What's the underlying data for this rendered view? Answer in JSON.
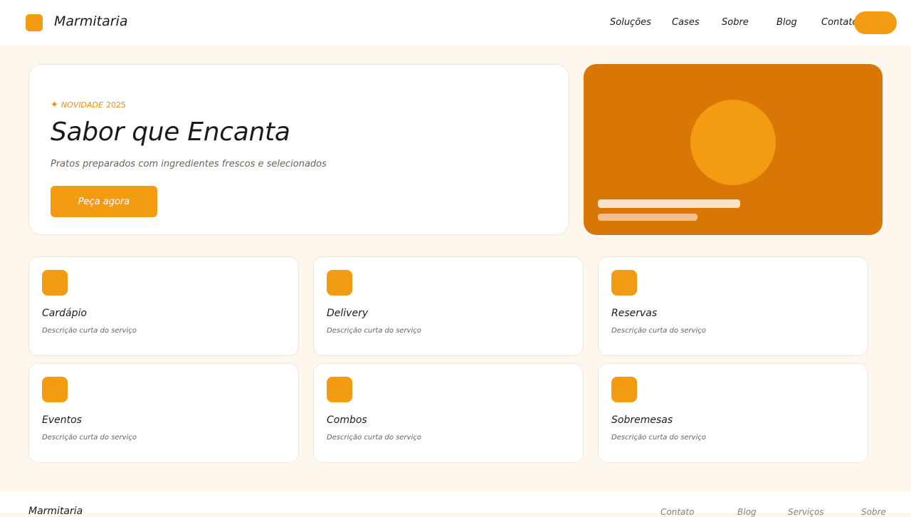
{
  "header": {
    "brand": "Marmitaria",
    "logo_icon": "logo-square-icon",
    "nav": [
      "Soluções",
      "Cases",
      "Sobre",
      "Blog",
      "Contato"
    ],
    "cta_color": "#f39c12"
  },
  "hero": {
    "eyebrow_icon": "✦",
    "eyebrow_label": "NOVIDADE",
    "eyebrow_year": "2025",
    "title": "Sabor que Encanta",
    "subtitle": "Pratos preparados com ingredientes frescos e selecionados",
    "button_label": "Peça agora"
  },
  "promo": {
    "background": "#d97706",
    "accent": "#f39c12"
  },
  "services": [
    {
      "title": "Cardápio",
      "description": "Descrição curta do serviço"
    },
    {
      "title": "Delivery",
      "description": "Descrição curta do serviço"
    },
    {
      "title": "Reservas",
      "description": "Descrição curta do serviço"
    },
    {
      "title": "Eventos",
      "description": "Descrição curta do serviço"
    },
    {
      "title": "Combos",
      "description": "Descrição curta do serviço"
    },
    {
      "title": "Sobremesas",
      "description": "Descrição curta do serviço"
    }
  ],
  "footer": {
    "brand": "Marmitaria",
    "links": [
      "Contato",
      "Blog",
      "Serviços",
      "Sobre"
    ]
  },
  "colors": {
    "accent": "#f39c12",
    "page_background": "#fdf7ee",
    "text": "#1f1a17"
  }
}
